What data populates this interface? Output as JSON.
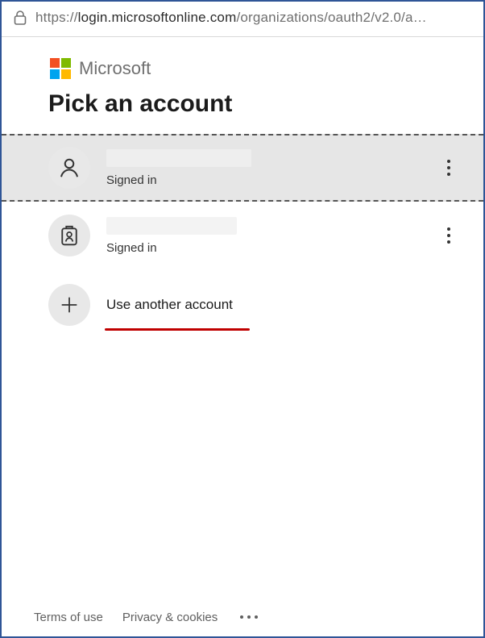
{
  "url": {
    "scheme": "https://",
    "host": "login.microsoftonline.com",
    "path_display": "/organizations/oauth2/v2.0/a…"
  },
  "brand": {
    "name": "Microsoft"
  },
  "page": {
    "heading": "Pick an account"
  },
  "logo_colors": {
    "tl": "#f25022",
    "tr": "#7fba00",
    "bl": "#00a4ef",
    "br": "#ffb900"
  },
  "accounts": [
    {
      "status": "Signed in",
      "selected": true
    },
    {
      "status": "Signed in",
      "selected": false
    }
  ],
  "add_account": {
    "label": "Use another account"
  },
  "footer": {
    "terms": "Terms of use",
    "privacy": "Privacy & cookies"
  },
  "annotation": {
    "underline_color": "#c00000"
  }
}
